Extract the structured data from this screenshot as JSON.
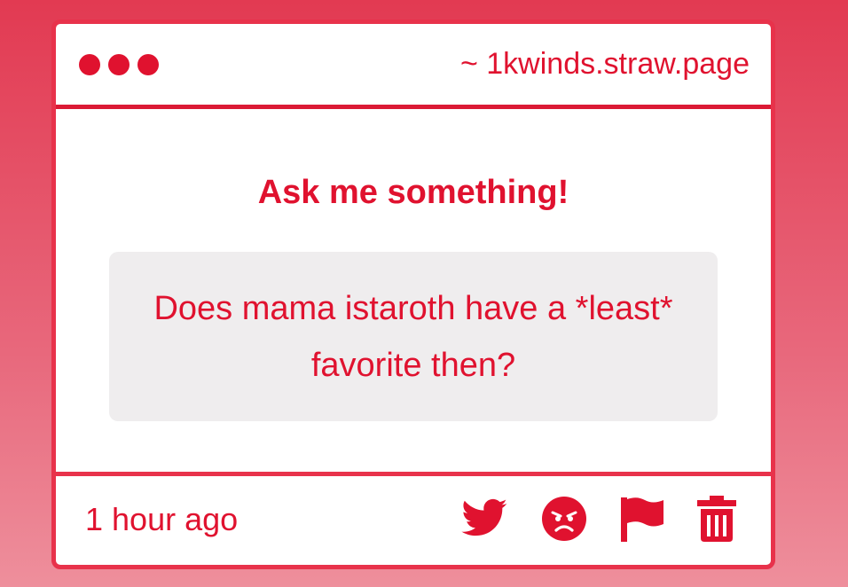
{
  "window": {
    "url_label": "~ 1kwinds.straw.page"
  },
  "main": {
    "heading": "Ask me something!",
    "question": "Does mama istaroth have a *least* favorite then?"
  },
  "footer": {
    "timestamp": "1 hour ago",
    "actions": [
      {
        "icon": "twitter-icon"
      },
      {
        "icon": "angry-face-icon"
      },
      {
        "icon": "flag-icon"
      },
      {
        "icon": "trash-icon"
      }
    ]
  },
  "colors": {
    "accent": "#e0122f",
    "border": "#e8324b",
    "question_bg": "#efedee"
  }
}
